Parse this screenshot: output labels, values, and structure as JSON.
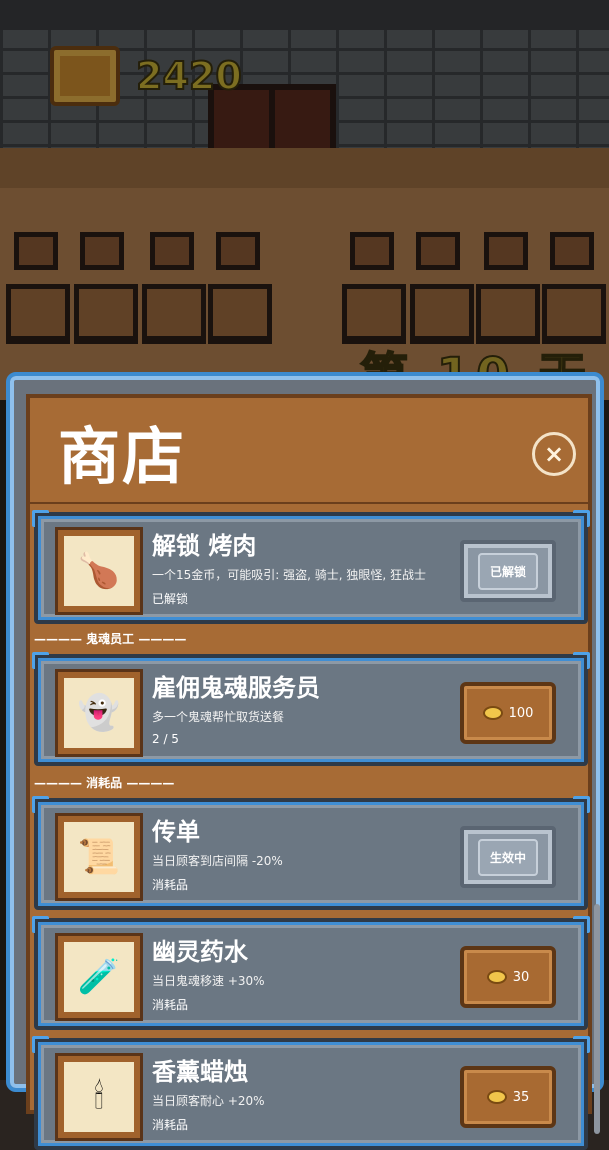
{
  "hud": {
    "gold": "2420",
    "day_banner": "第 10 天"
  },
  "shop": {
    "title": "商店",
    "close_label": "×",
    "sections": {
      "ghost_staff": "———— 鬼魂员工 ————",
      "consumables": "———— 消耗品 ————"
    },
    "items": [
      {
        "name": "解锁 烤肉",
        "icon": "roast-meat-icon",
        "description": "一个15金币，可能吸引: 强盗, 骑士, 独眼怪, 狂战士",
        "status": "已解锁",
        "button": "已解锁"
      },
      {
        "name": "雇佣鬼魂服务员",
        "icon": "ghost-waiter-icon",
        "description": "多一个鬼魂帮忙取货送餐",
        "status": "2 / 5",
        "price": "100"
      },
      {
        "name": "传单",
        "icon": "flyer-icon",
        "description": "当日顾客到店间隔 -20%",
        "status": "消耗品",
        "button": "生效中"
      },
      {
        "name": "幽灵药水",
        "icon": "potion-icon",
        "description": "当日鬼魂移速 +30%",
        "status": "消耗品",
        "price": "30"
      },
      {
        "name": "香薰蜡烛",
        "icon": "candle-icon",
        "description": "当日顾客耐心 +20%",
        "status": "消耗品",
        "price": "35"
      }
    ]
  },
  "colors": {
    "panel_border": "#3c8bd0",
    "panel_wood": "#a76b35",
    "card": "#6b7783",
    "gold_text": "#c9b236"
  }
}
